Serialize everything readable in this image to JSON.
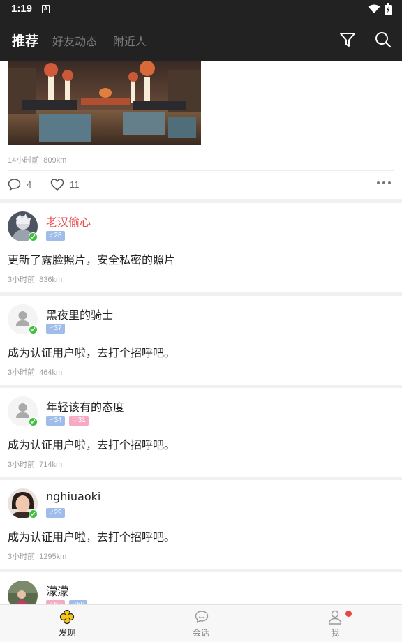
{
  "status": {
    "time": "1:19",
    "notification_icon": "a-icon"
  },
  "header": {
    "tabs": [
      {
        "label": "推荐",
        "active": true
      },
      {
        "label": "好友动态",
        "active": false
      },
      {
        "label": "附近人",
        "active": false
      }
    ],
    "icons": [
      "filter-icon",
      "search-icon"
    ]
  },
  "first_card": {
    "time": "14小时前",
    "distance": "809km",
    "comments": "4",
    "likes": "11"
  },
  "posts": [
    {
      "name": "老汉偷心",
      "vip": true,
      "gender": "♂",
      "age": "28",
      "text": "更新了露脸照片，安全私密的照片",
      "time": "3小时前",
      "distance": "836km"
    },
    {
      "name": "黑夜里的骑士",
      "gender": "♂",
      "age": "37",
      "text": "成为认证用户啦，去打个招呼吧。",
      "time": "3小时前",
      "distance": "464km"
    },
    {
      "name": "年轻该有的态度",
      "gender": "♂",
      "age": "34",
      "extra": "31",
      "text": "成为认证用户啦，去打个招呼吧。",
      "time": "3小时前",
      "distance": "714km"
    },
    {
      "name": "nghiuaoki",
      "gender": "♂",
      "age": "29",
      "text": "成为认证用户啦，去打个招呼吧。",
      "time": "3小时前",
      "distance": "1295km"
    },
    {
      "name": "濛濛",
      "badge_a": "52",
      "badge_b": "50"
    }
  ],
  "bottom_nav": [
    {
      "label": "发现",
      "icon": "clover-icon",
      "active": true
    },
    {
      "label": "会话",
      "icon": "chat-icon",
      "active": false
    },
    {
      "label": "我",
      "icon": "person-icon",
      "active": false,
      "has_dot": true
    }
  ],
  "colors": {
    "header_bg": "#222222",
    "vip_name": "#ee4b4b",
    "age_badge": "#9fbde8",
    "pink_badge": "#f5a9c2",
    "verified": "#3fbf3f"
  }
}
